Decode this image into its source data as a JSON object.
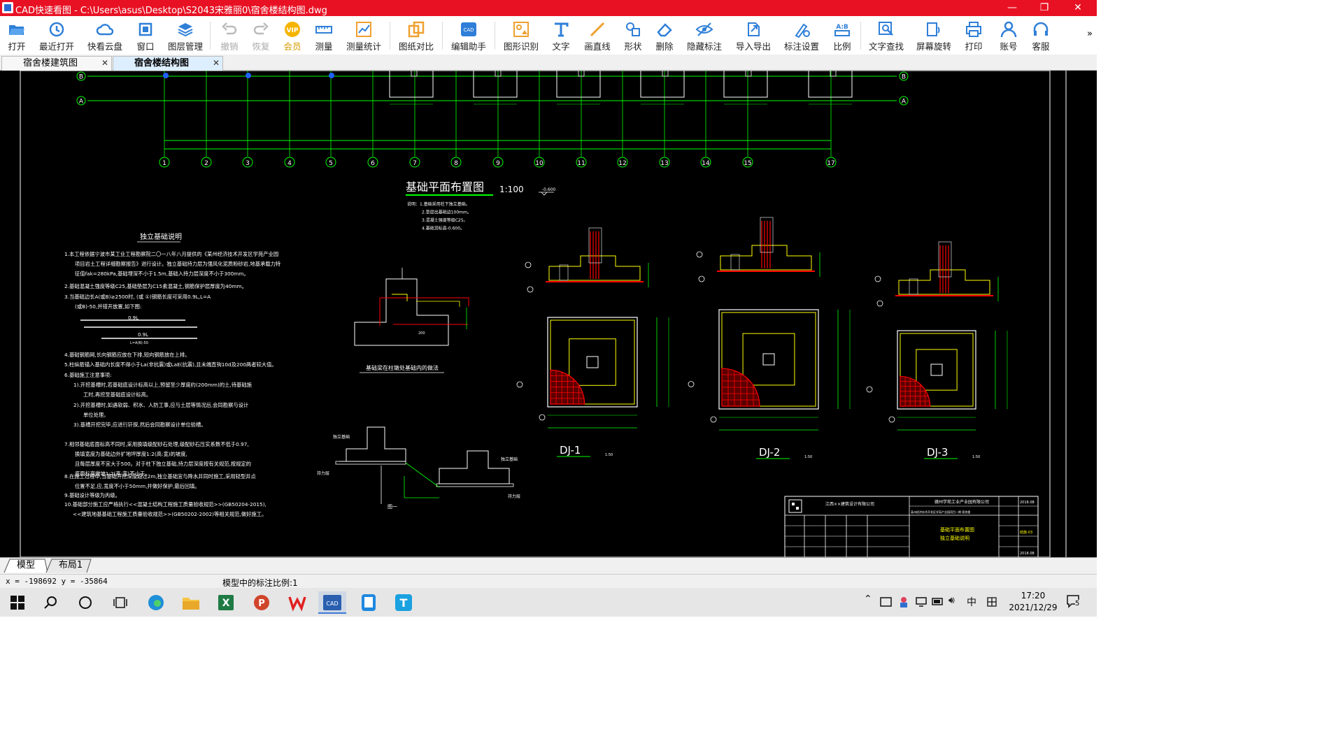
{
  "window": {
    "title": "CAD快速看图 - C:\\Users\\asus\\Desktop\\S2043宋雅丽0\\宿舍楼结构图.dwg",
    "controls": {
      "minimize": "—",
      "maximize": "❐",
      "close": "✕"
    }
  },
  "toolbar": {
    "items": [
      {
        "label": "打开",
        "icon": "folder-open-icon"
      },
      {
        "label": "最近打开",
        "icon": "recent-icon"
      },
      {
        "label": "快看云盘",
        "icon": "cloud-icon"
      },
      {
        "label": "窗口",
        "icon": "window-icon"
      },
      {
        "label": "图层管理",
        "icon": "layers-icon"
      },
      {
        "label": "撤销",
        "icon": "undo-icon"
      },
      {
        "label": "恢复",
        "icon": "redo-icon"
      },
      {
        "label": "会员",
        "icon": "vip-icon"
      },
      {
        "label": "测量",
        "icon": "ruler-icon"
      },
      {
        "label": "测量统计",
        "icon": "measure-stats-icon"
      },
      {
        "label": "图纸对比",
        "icon": "compare-icon"
      },
      {
        "label": "编辑助手",
        "icon": "edit-assistant-icon"
      },
      {
        "label": "图形识别",
        "icon": "shape-recognize-icon"
      },
      {
        "label": "文字",
        "icon": "text-icon"
      },
      {
        "label": "画直线",
        "icon": "line-icon"
      },
      {
        "label": "形状",
        "icon": "shape-icon"
      },
      {
        "label": "删除",
        "icon": "eraser-icon"
      },
      {
        "label": "隐藏标注",
        "icon": "hide-icon"
      },
      {
        "label": "导入导出",
        "icon": "import-export-icon"
      },
      {
        "label": "标注设置",
        "icon": "annotation-settings-icon"
      },
      {
        "label": "比例",
        "icon": "scale-icon"
      },
      {
        "label": "文字查找",
        "icon": "text-search-icon"
      },
      {
        "label": "屏幕旋转",
        "icon": "rotate-icon"
      },
      {
        "label": "打印",
        "icon": "printer-icon"
      },
      {
        "label": "账号",
        "icon": "user-icon"
      },
      {
        "label": "客服",
        "icon": "headset-icon"
      }
    ],
    "more": "»"
  },
  "doc_tabs": [
    {
      "label": "宿舍楼建筑图",
      "close": "✕"
    },
    {
      "label": "宿舍楼结构图",
      "close": "✕",
      "active": true
    }
  ],
  "drawing": {
    "axis_rows": [
      "B",
      "A"
    ],
    "axis_cols": [
      "1",
      "2",
      "3",
      "4",
      "5",
      "6",
      "7",
      "8",
      "9",
      "10",
      "11",
      "12",
      "13",
      "14",
      "15",
      "17"
    ],
    "plan_title": "基础平面布置图",
    "plan_scale": "1:100",
    "plan_elev": "-0.600",
    "plan_notes": [
      "说明：1.基础采用柱下独立基础。",
      "2.垫层出基础边100mm。",
      "3.混凝土强度等级C25。",
      "4.基础顶标高-0.600。"
    ],
    "found_title": "独立基础说明",
    "found_notes": [
      "1.本工程依据宁波市某工业工程勘察院二〇一八年八月提供的《某州经济技术开发区学苑产业园",
      "项目岩土工程详细勘察报告》进行设计。独立基础持力层为强风化泥质粉砂岩,地基承载力特",
      "征值fak=280kPa,基础埋深不小于1.5m,基础入持力层深度不小于300mm。",
      "2.基础混凝土强度等级C25,基础垫层为C15素混凝土,钢筋保护层厚度为40mm。",
      "3.当基础边长A(或B)≥2500时, (或 ①)钢筋长度可采用0.9L,L=A",
      "(或B)-50,并错开放置,如下图:",
      "4.基础钢筋网,长向钢筋应放在下排,短向钢筋放在上排。",
      "5.柱纵筋锚入基础内长度不得小于La(非抗震)或LaE(抗震),且末端直钩10d及200两者较大值。",
      "6.基础施工注意事项:",
      "1).开挖基槽时,若基础底设计标高以上,预留至少厚度约(200mm)的土,待基础施",
      "工时,再挖至基础底设计标高。",
      "2).开挖基槽时,如遇软弱、积水、人防工事,应与土层等情况后,会同勘察与设计",
      "单位处理。",
      "3).基槽开挖完毕,应进行钎探,然后会同勘察设计单位验槽。",
      "7.相邻基础底面标高不同时,采用换填级配砂石处理,级配砂石压实系数不低于0.97,",
      "换填宽度为基础边外扩地坪厚度1:2(高:宽)的坡度,",
      "且每层厚度不宜大于500。对于柱下独立基础,持力层深度按有关规范,按规定的",
      "底面标高做坡1:2(高:宽)不小于。",
      "8.在施工过程中,当基础开挖深度超过2m,独立基础宜与降水井同时施工,采用轻型井点",
      "位置不足,应,宽度不小于50mm,并做好保护,最后回填。",
      "9.基础设计等级为丙级。",
      "10.基础部分施工应严格执行<<混凝土结构工程施工质量验收规范>>(GB50204-2015),",
      "<<建筑地基基础工程施工质量验收规范>>(GB50202-2002)等相关规范,做好施工。"
    ],
    "dim_09L": "0.9L",
    "dim_L": "L=A(B)-50",
    "detail_caption": "基础梁在柱墩处基础内的做法",
    "step_caption": "图一",
    "step_labels": [
      "独立基础",
      "独立基础",
      "持力层",
      "持力层"
    ],
    "dj": [
      {
        "label": "DJ-1",
        "scale": "1:50"
      },
      {
        "label": "DJ-2",
        "scale": "1:50"
      },
      {
        "label": "DJ-3",
        "scale": "1:50"
      }
    ],
    "titleblock": {
      "company": "江西××建筑设计有限公司",
      "client": "赣州学苑工业产业园有限公司",
      "project": "某州经济技术开发区学苑产业园项目一期 宿舍楼",
      "sheet1": "基础平面布置图",
      "sheet2": "独立基础说明",
      "date": "2018.08",
      "sheet_no": "结施-03"
    }
  },
  "layout_tabs": [
    "模型",
    "布局1"
  ],
  "status": {
    "coords": "x = -198692 y = -35864",
    "scale_text": "模型中的标注比例:1"
  },
  "taskbar": {
    "time": "17:20",
    "date": "2021/12/29",
    "ime": "中",
    "notifications": "5",
    "apps": [
      "start-icon",
      "search-icon",
      "cortana-icon",
      "taskview-icon",
      "edge-icon",
      "explorer-icon",
      "excel-icon",
      "powerpoint-icon",
      "wps-icon",
      "cad-icon",
      "tablet-icon",
      "typora-icon"
    ]
  },
  "colors": {
    "titlebar": "#e81123",
    "canvas": "#000000",
    "cad_green": "#00ff00",
    "cad_yellow": "#ffff00",
    "cad_red": "#ff0000",
    "cad_white": "#ffffff"
  }
}
